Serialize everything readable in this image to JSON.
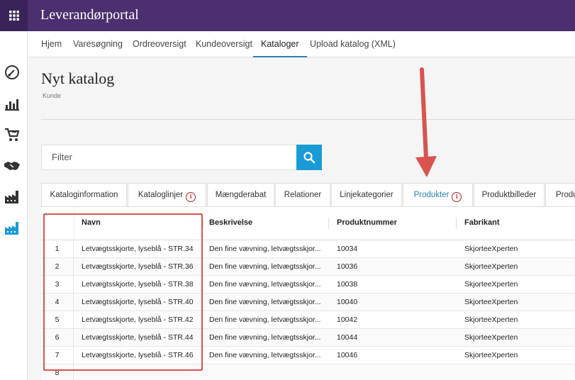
{
  "header": {
    "title": "Leverandørportal"
  },
  "sidebar": {
    "icons": [
      "dashboard-icon",
      "bar-chart-icon",
      "cart-icon",
      "handshake-icon",
      "factory-icon",
      "factory-active-icon"
    ]
  },
  "nav": {
    "items": [
      {
        "label": "Hjem"
      },
      {
        "label": "Varesøgning"
      },
      {
        "label": "Ordreoversigt"
      },
      {
        "label": "Kundeoversigt"
      },
      {
        "label": "Kataloger",
        "active": true
      },
      {
        "label": "Upload katalog (XML)"
      }
    ]
  },
  "page": {
    "title": "Nyt katalog",
    "subtitle": "Kunde"
  },
  "filter": {
    "placeholder": "Filter"
  },
  "tabs": [
    {
      "label": "Kataloginformation"
    },
    {
      "label": "Katalog­linjer",
      "info": "i"
    },
    {
      "label": "Mængderabat"
    },
    {
      "label": "Relationer"
    },
    {
      "label": "Linjekategorier"
    },
    {
      "label": "Produkter",
      "info": "i",
      "active": true
    },
    {
      "label": "Produktbilleder"
    },
    {
      "label": "Produ"
    }
  ],
  "grid": {
    "columns": [
      "Navn",
      "Beskrivelse",
      "Produktnummer",
      "Fabrikant"
    ],
    "rows": [
      {
        "num": "1",
        "navn": "Letvægtsskjorte, lyseblå - STR.34",
        "beskrivelse": "Den fine vævning, letvægtsskjor...",
        "produktnummer": "10034",
        "fabrikant": "SkjorteeXperten"
      },
      {
        "num": "2",
        "navn": "Letvægtsskjorte, lyseblå - STR.36",
        "beskrivelse": "Den fine vævning, letvægtsskjor...",
        "produktnummer": "10036",
        "fabrikant": "SkjorteeXperten"
      },
      {
        "num": "3",
        "navn": "Letvægtsskjorte, lyseblå - STR.38",
        "beskrivelse": "Den fine vævning, letvægtsskjor...",
        "produktnummer": "10038",
        "fabrikant": "SkjorteeXperten"
      },
      {
        "num": "4",
        "navn": "Letvægtsskjorte, lyseblå - STR.40",
        "beskrivelse": "Den fine vævning, letvægtsskjor...",
        "produktnummer": "10040",
        "fabrikant": "SkjorteeXperten"
      },
      {
        "num": "5",
        "navn": "Letvægtsskjorte, lyseblå - STR.42",
        "beskrivelse": "Den fine vævning, letvægtsskjor...",
        "produktnummer": "10042",
        "fabrikant": "SkjorteeXperten"
      },
      {
        "num": "6",
        "navn": "Letvægtsskjorte, lyseblå - STR.44",
        "beskrivelse": "Den fine vævning, letvægtsskjor...",
        "produktnummer": "10044",
        "fabrikant": "SkjorteeXperten"
      },
      {
        "num": "7",
        "navn": "Letvægtsskjorte, lyseblå - STR.46",
        "beskrivelse": "Den fine vævning, letvægtsskjor...",
        "produktnummer": "10046",
        "fabrikant": "SkjorteeXperten"
      },
      {
        "num": "8",
        "navn": "",
        "beskrivelse": "",
        "produktnummer": "",
        "fabrikant": ""
      }
    ]
  },
  "colors": {
    "topbar": "#4b2f6e",
    "accent": "#1a9bd6",
    "annotation": "#d9534f"
  }
}
